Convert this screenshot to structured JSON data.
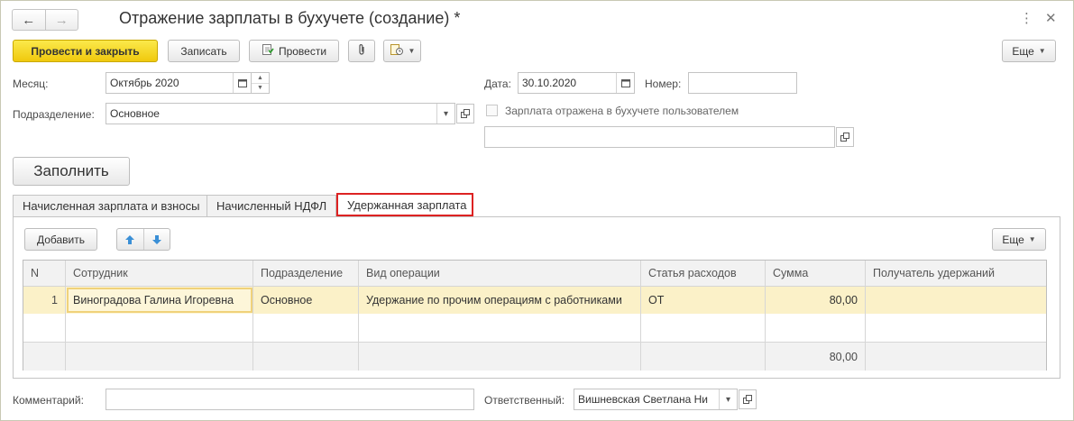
{
  "window": {
    "title": "Отражение зарплаты в бухучете (создание) *",
    "back_icon": "←",
    "forward_icon": "→",
    "more_icon": "⋮",
    "close_icon": "✕"
  },
  "toolbar": {
    "post_close": "Провести и закрыть",
    "save": "Записать",
    "post": "Провести",
    "attach_icon": "📎",
    "more": "Еще"
  },
  "form": {
    "month_label": "Месяц:",
    "month_value": "Октябрь 2020",
    "date_label": "Дата:",
    "date_value": "30.10.2020",
    "number_label": "Номер:",
    "number_value": "",
    "department_label": "Подразделение:",
    "department_value": "Основное",
    "reflected_label": "Зарплата отражена в бухучете пользователем",
    "reflected_checked": false,
    "reflected_user_value": "",
    "fill_button": "Заполнить",
    "comment_label": "Комментарий:",
    "comment_value": "",
    "responsible_label": "Ответственный:",
    "responsible_value": "Вишневская Светлана Ни"
  },
  "tabs": [
    {
      "label": "Начисленная зарплата и взносы",
      "active": false
    },
    {
      "label": "Начисленный НДФЛ",
      "active": false
    },
    {
      "label": "Удержанная зарплата",
      "active": true
    }
  ],
  "grid_toolbar": {
    "add": "Добавить",
    "more": "Еще",
    "up_icon": "arrow-up",
    "down_icon": "arrow-down"
  },
  "table": {
    "columns": [
      "N",
      "Сотрудник",
      "Подразделение",
      "Вид операции",
      "Статья расходов",
      "Сумма",
      "Получатель удержаний"
    ],
    "rows": [
      [
        "1",
        "Виноградова Галина Игоревна",
        "Основное",
        "Удержание по прочим операциям с работниками",
        "ОТ",
        "80,00",
        ""
      ]
    ],
    "total": "80,00"
  }
}
